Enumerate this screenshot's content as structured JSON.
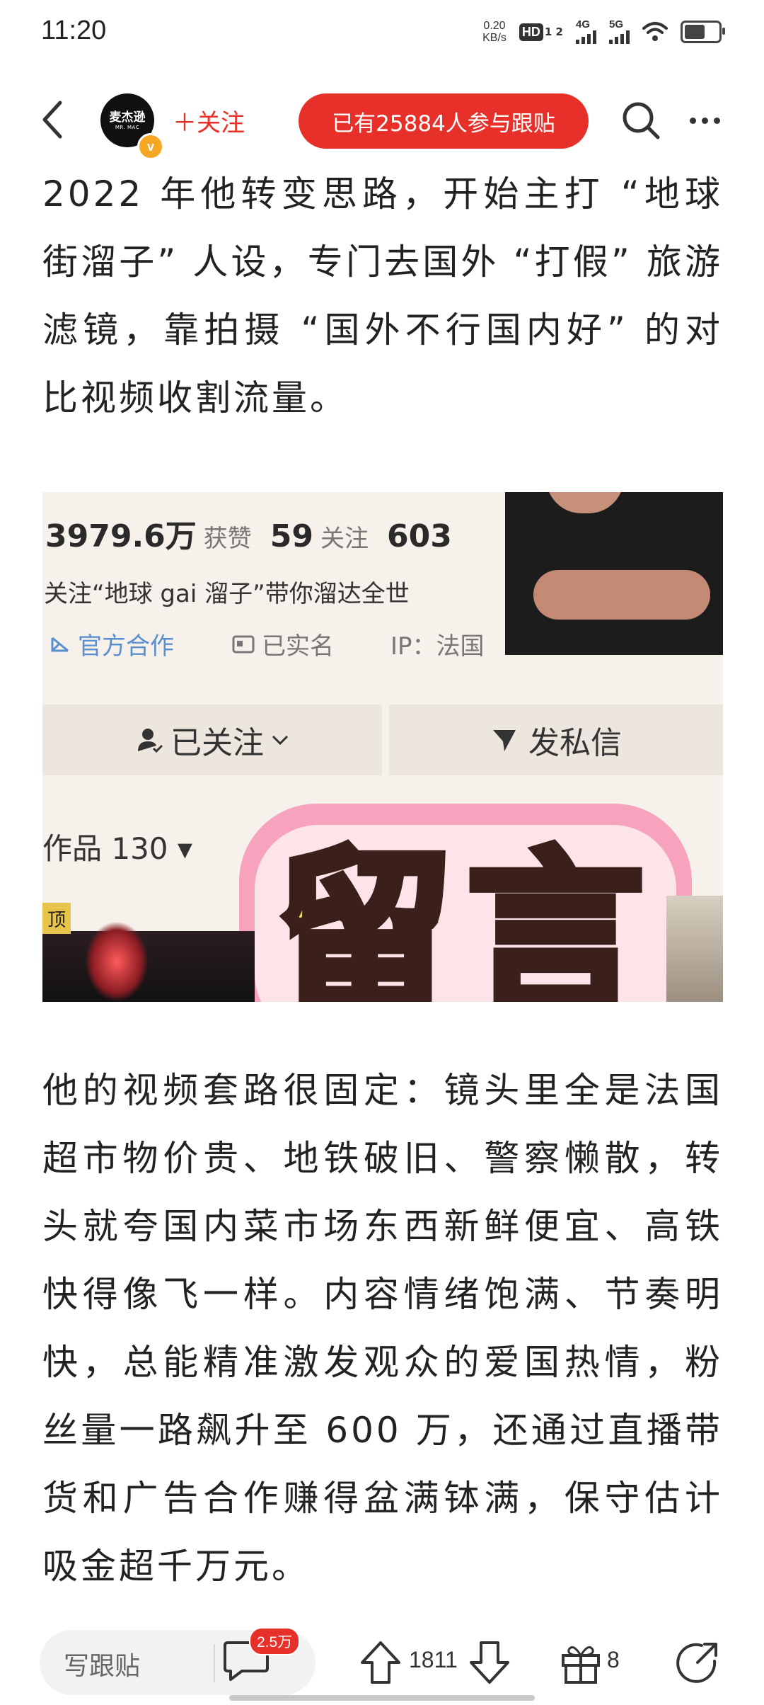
{
  "status_bar": {
    "time": "11:20",
    "net_speed_value": "0.20",
    "net_speed_unit": "KB/s",
    "hd_label": "HD",
    "hd_sub": "1 2",
    "signal_1_label": "4G",
    "signal_2_label": "5G",
    "battery_level": 0.6
  },
  "nav": {
    "avatar_name": "麦杰逊",
    "avatar_sub": "MR. MAC",
    "follow_label": "＋关注",
    "participants_label": "已有25884人参与跟贴"
  },
  "article": {
    "paragraph_1": "2022 年他转变思路，开始主打 “地球街溜子” 人设，专门去国外 “打假” 旅游滤镜，靠拍摄 “国外不行国内好” 的对比视频收割流量。",
    "paragraph_2": "他的视频套路很固定：镜头里全是法国超市物价贵、地铁破旧、警察懒散，转头就夸国内菜市场东西新鲜便宜、高铁快得像飞一样。内容情绪饱满、节奏明快，总能精准激发观众的爱国热情，粉丝量一路飙升至 600 万，还通过直播带货和广告合作赚得盆满钵满，保守估计吸金超千万元。"
  },
  "embed": {
    "likes_value": "3979.6万",
    "likes_label": "获赞",
    "following_value": "59",
    "following_label": "关注",
    "followers_value": "603",
    "bio": "关注“地球 gai 溜子”带你溜达全世",
    "tag_official": "官方合作",
    "tag_realname": "已实名",
    "tag_ip": "IP：法国",
    "follow_state": "已关注",
    "dm_label": "发私信",
    "works_label": "作品 130 ▾",
    "pin_label": "顶",
    "sticker_text": "留言"
  },
  "bottom_bar": {
    "reply_placeholder": "写跟贴",
    "comment_badge": "2.5万",
    "vote_count": "1811",
    "gift_count": "8"
  },
  "colors": {
    "accent": "#e8302a",
    "text": "#222222",
    "icon": "#333333"
  },
  "icons": [
    "back-arrow-icon",
    "search-icon",
    "more-icon",
    "verified-icon",
    "comment-icon",
    "upvote-icon",
    "downvote-icon",
    "gift-icon",
    "share-icon",
    "wifi-icon",
    "battery-icon"
  ]
}
